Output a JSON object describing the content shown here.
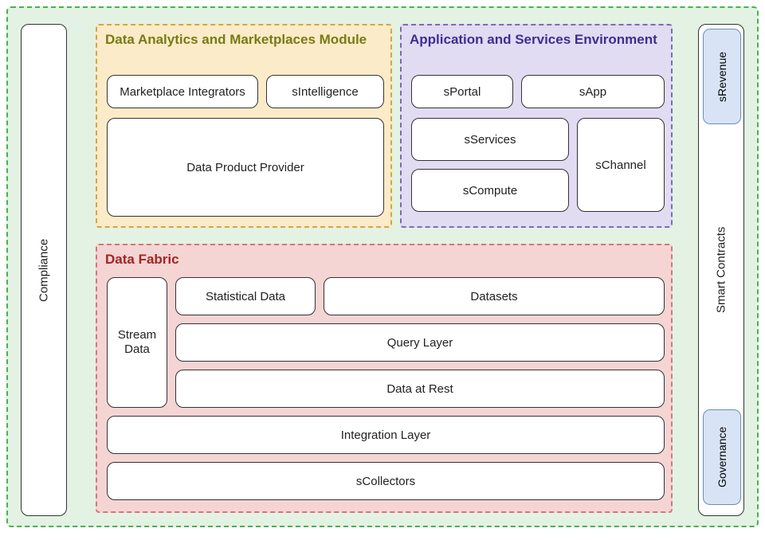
{
  "outer_label": "",
  "left_pillar": "Compliance",
  "right_pillar": "Smart Contracts",
  "badges": {
    "top": "sRevenue",
    "bottom": "Governance"
  },
  "analytics": {
    "title": "Data Analytics and Marketplaces Module",
    "items": {
      "mi": "Marketplace Integrators",
      "si": "sIntelligence",
      "dpp": "Data Product Provider"
    }
  },
  "app_env": {
    "title": "Application and Services Environment",
    "items": {
      "portal": "sPortal",
      "sapp": "sApp",
      "services": "sServices",
      "compute": "sCompute",
      "channel": "sChannel"
    }
  },
  "fabric": {
    "title": "Data Fabric",
    "items": {
      "stream": "Stream Data",
      "stat": "Statistical Data",
      "datasets": "Datasets",
      "query": "Query Layer",
      "rest": "Data at Rest",
      "integration": "Integration Layer",
      "collectors": "sCollectors"
    }
  }
}
